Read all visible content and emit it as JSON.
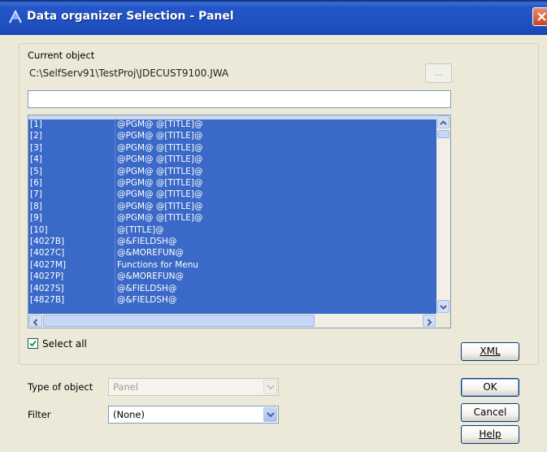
{
  "window": {
    "title": "Data organizer Selection - Panel"
  },
  "current_object": {
    "label": "Current object",
    "path": "C:\\SelfServ91\\TestProj\\JDECUST9100.JWA",
    "browse_label": "..."
  },
  "list": {
    "rows": [
      {
        "id": "[1]",
        "value": "@PGM@   @[TITLE]@"
      },
      {
        "id": "[2]",
        "value": "@PGM@   @[TITLE]@"
      },
      {
        "id": "[3]",
        "value": "@PGM@   @[TITLE]@"
      },
      {
        "id": "[4]",
        "value": "@PGM@   @[TITLE]@"
      },
      {
        "id": "[5]",
        "value": "@PGM@   @[TITLE]@"
      },
      {
        "id": "[6]",
        "value": "@PGM@   @[TITLE]@"
      },
      {
        "id": "[7]",
        "value": "@PGM@   @[TITLE]@"
      },
      {
        "id": "[8]",
        "value": "@PGM@   @[TITLE]@"
      },
      {
        "id": "[9]",
        "value": "@PGM@   @[TITLE]@"
      },
      {
        "id": "[10]",
        "value": "@[TITLE]@"
      },
      {
        "id": "[4027B]",
        "value": "@&FIELDSH@"
      },
      {
        "id": "[4027C]",
        "value": "@&MOREFUN@"
      },
      {
        "id": "[4027M]",
        "value": "Functions for Menu"
      },
      {
        "id": "[4027P]",
        "value": "@&MOREFUN@"
      },
      {
        "id": "[4027S]",
        "value": "@&FIELDSH@"
      },
      {
        "id": "[4827B]",
        "value": "@&FIELDSH@"
      }
    ]
  },
  "select_all": {
    "label": "Select all",
    "checked": true
  },
  "buttons": {
    "xml": "XML",
    "ok": "OK",
    "cancel": "Cancel",
    "help": "Help"
  },
  "type_of_object": {
    "label": "Type of object",
    "value": "Panel"
  },
  "filter": {
    "label": "Filter",
    "value": "(None)"
  },
  "colors": {
    "selection": "#3a69c7",
    "titlebar": "#2456c8",
    "face": "#ece9d8"
  }
}
